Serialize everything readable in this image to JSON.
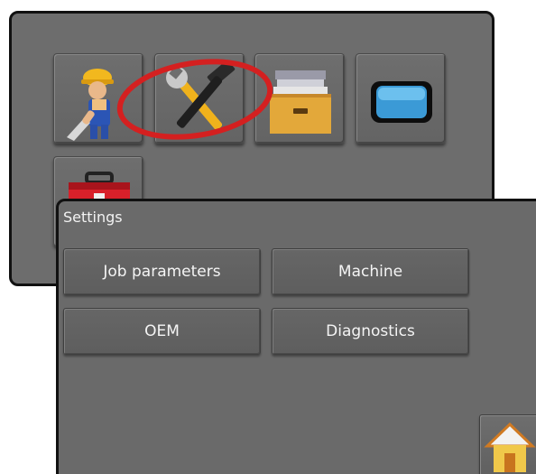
{
  "main_menu": {
    "icons": [
      {
        "name": "worker-icon"
      },
      {
        "name": "wrench-hammer-icon"
      },
      {
        "name": "file-cabinet-icon"
      },
      {
        "name": "screen-icon"
      },
      {
        "name": "toolbox-icon"
      }
    ]
  },
  "settings": {
    "title": "Settings",
    "buttons": {
      "job_parameters": "Job parameters",
      "machine": "Machine",
      "oem": "OEM",
      "diagnostics": "Diagnostics"
    },
    "home_icon": "home-icon"
  },
  "colors": {
    "panel_gray": "#6d6d6d",
    "highlight_red": "#d42020",
    "border_black": "#111111"
  }
}
